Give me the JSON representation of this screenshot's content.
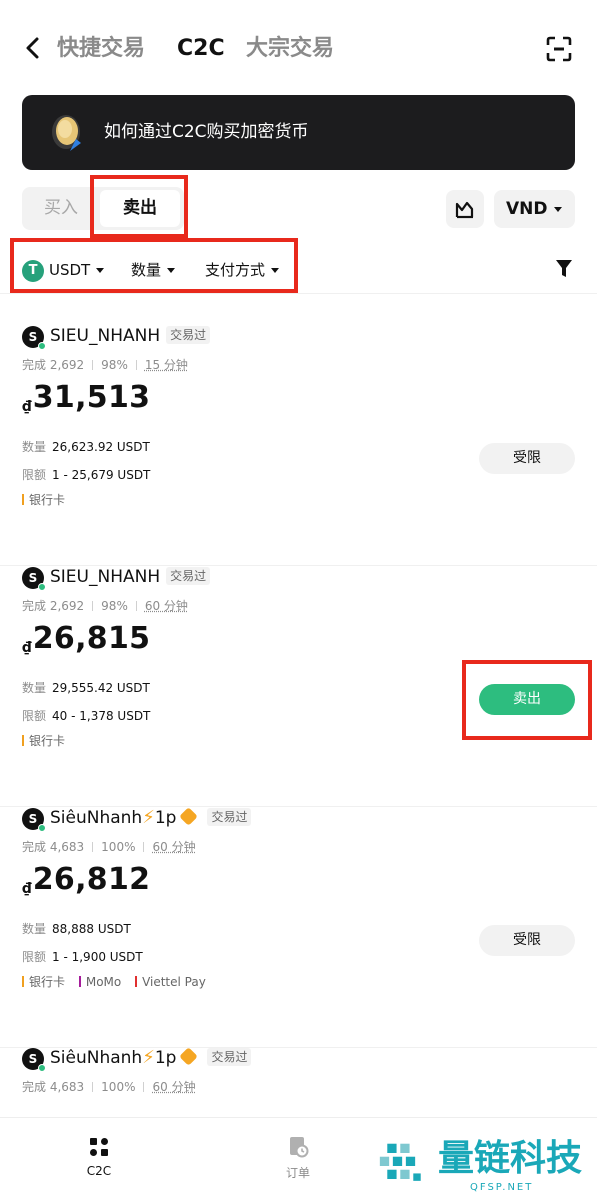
{
  "header": {
    "tabs": [
      {
        "label": "快捷交易",
        "active": false
      },
      {
        "label": "C2C",
        "active": true
      },
      {
        "label": "大宗交易",
        "active": false
      }
    ],
    "icons": {
      "back": "chevron-left-icon",
      "scan": "scan-icon"
    }
  },
  "banner": {
    "text": "如何通过C2C购买加密货币",
    "icon": "coin-icon"
  },
  "trade_side": {
    "buy_label": "买入",
    "sell_label": "卖出",
    "selected": "卖出"
  },
  "fiat": {
    "label": "VND"
  },
  "filters": {
    "coin": "USDT",
    "coin_symbol": "T",
    "amount": "数量",
    "payment": "支付方式"
  },
  "ads": [
    {
      "merchant": "SIEU_NHANH",
      "avatar_letter": "S",
      "suffix": "",
      "tag": "交易过",
      "completed": "完成 2,692",
      "rate": "98%",
      "time": "15 分钟",
      "currency_symbol": "₫",
      "price": "31,513",
      "quantity_label": "数量",
      "quantity": "26,623.92 USDT",
      "limit_label": "限额",
      "limit": "1 - 25,679 USDT",
      "payments": [
        {
          "name": "银行卡",
          "color": "#f0a020"
        }
      ],
      "action": "受限",
      "action_type": "limited"
    },
    {
      "merchant": "SIEU_NHANH",
      "avatar_letter": "S",
      "suffix": "",
      "tag": "交易过",
      "completed": "完成 2,692",
      "rate": "98%",
      "time": "60 分钟",
      "currency_symbol": "₫",
      "price": "26,815",
      "quantity_label": "数量",
      "quantity": "29,555.42 USDT",
      "limit_label": "限额",
      "limit": "40 - 1,378 USDT",
      "payments": [
        {
          "name": "银行卡",
          "color": "#f0a020"
        }
      ],
      "action": "卖出",
      "action_type": "sell"
    },
    {
      "merchant": "SiêuNhanh",
      "avatar_letter": "S",
      "suffix": "1p",
      "tag": "交易过",
      "completed": "完成 4,683",
      "rate": "100%",
      "time": "60 分钟",
      "currency_symbol": "₫",
      "price": "26,812",
      "quantity_label": "数量",
      "quantity": "88,888 USDT",
      "limit_label": "限额",
      "limit": "1 - 1,900 USDT",
      "payments": [
        {
          "name": "银行卡",
          "color": "#f0a020"
        },
        {
          "name": "MoMo",
          "color": "#a51c9a"
        },
        {
          "name": "Viettel Pay",
          "color": "#e03030"
        }
      ],
      "action": "受限",
      "action_type": "limited"
    },
    {
      "merchant": "SiêuNhanh",
      "avatar_letter": "S",
      "suffix": "1p",
      "tag": "交易过",
      "completed": "完成 4,683",
      "rate": "100%",
      "time": "60 分钟"
    }
  ],
  "bottom_nav": [
    {
      "label": "C2C",
      "icon": "c2c-icon",
      "active": true
    },
    {
      "label": "订单",
      "icon": "orders-icon",
      "active": false
    }
  ],
  "watermark": {
    "text": "量链科技",
    "url": "QFSP.NET"
  },
  "colors": {
    "accent_green": "#2dbd7f",
    "annotation_red": "#e8291c",
    "banner_bg": "#1c1c1e"
  }
}
